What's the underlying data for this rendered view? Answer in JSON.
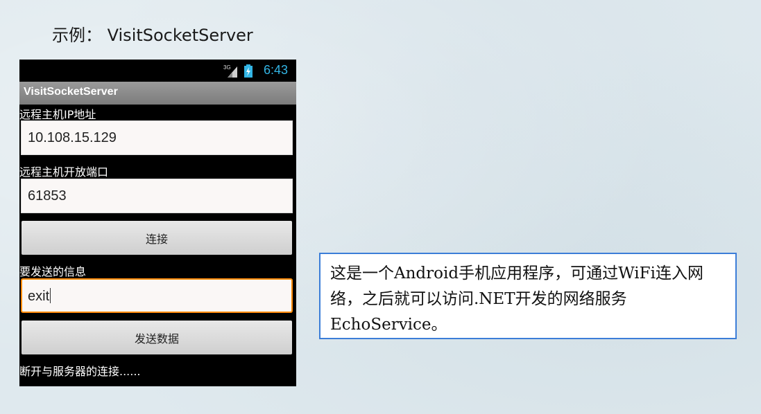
{
  "slide": {
    "title": "示例： VisitSocketServer"
  },
  "phone": {
    "statusbar": {
      "network": "3G",
      "time": "6:43",
      "signal_icon": "signal-icon",
      "battery_icon": "battery-charging-icon",
      "accent_color": "#33b5e5"
    },
    "appbar": {
      "title": "VisitSocketServer"
    },
    "ip_label": "远程主机IP地址",
    "ip_value": "10.108.15.129",
    "port_label": "远程主机开放端口",
    "port_value": "61853",
    "connect_button": "连接",
    "message_label": "要发送的信息",
    "message_value": "exit",
    "send_button": "发送数据",
    "status_message": "断开与服务器的连接......"
  },
  "note": {
    "text": "这是一个Android手机应用程序，可通过WiFi连入网络，之后就可以访问.NET开发的网络服务EchoService。",
    "border_color": "#3b7dd8"
  }
}
